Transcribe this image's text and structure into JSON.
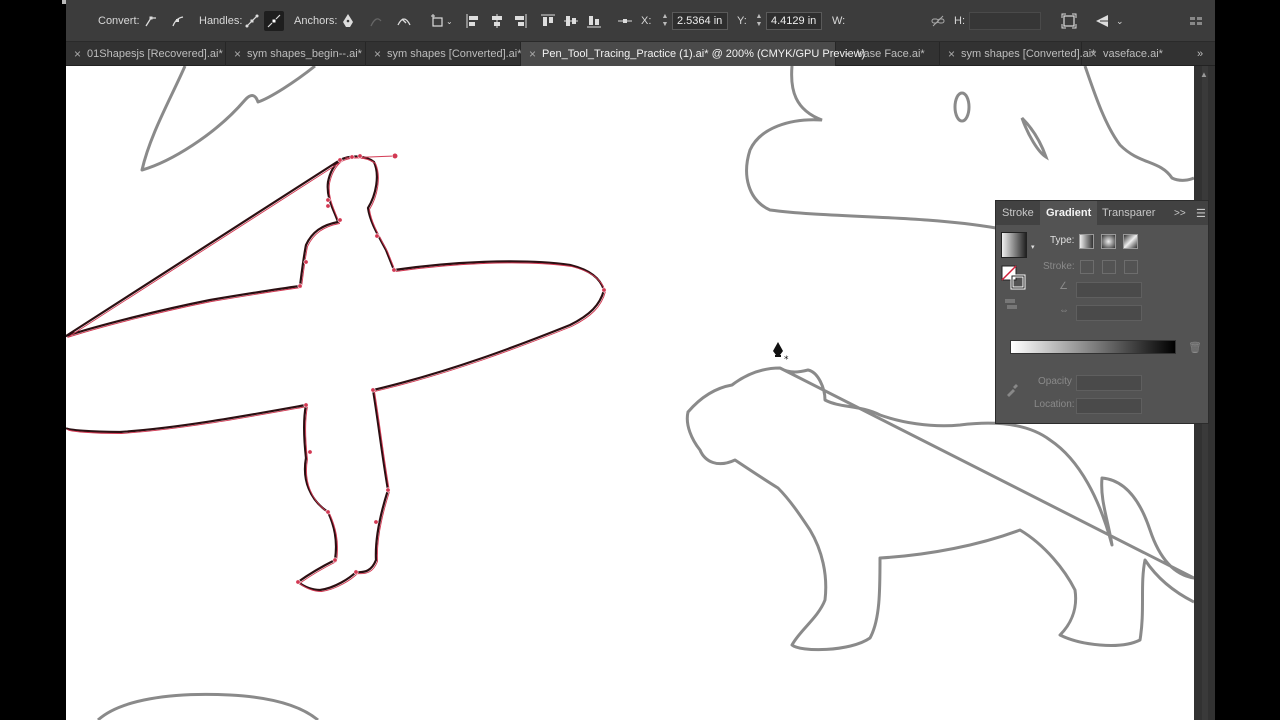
{
  "control_bar": {
    "convert_label": "Convert:",
    "handles_label": "Handles:",
    "anchors_label": "Anchors:",
    "x_label": "X:",
    "x_value": "2.5364 in",
    "y_label": "Y:",
    "y_value": "4.4129 in",
    "w_label": "W:",
    "h_label": "H:"
  },
  "tabs": [
    {
      "label": "01Shapesjs [Recovered].ai*",
      "active": false
    },
    {
      "label": "sym shapes_begin--.ai*",
      "active": false
    },
    {
      "label": "sym shapes [Converted].ai*",
      "active": false
    },
    {
      "label": "Pen_Tool_Tracing_Practice (1).ai* @ 200% (CMYK/GPU Preview)",
      "active": true
    },
    {
      "label": "Vase Face.ai*",
      "active": false
    },
    {
      "label": "sym shapes [Converted].ai*",
      "active": false
    },
    {
      "label": "vaseface.ai*",
      "active": false
    }
  ],
  "tab_close_glyph": "×",
  "tab_overflow": "»",
  "gradient_panel": {
    "tabs": [
      "Stroke",
      "Gradient",
      "Transparer"
    ],
    "active_tab": "Gradient",
    "type_label": "Type:",
    "stroke_label": "Stroke:",
    "opacity_label": "Opacity",
    "location_label": "Location:",
    "overflow": ">>"
  },
  "colors": {
    "accent_path": "#c8304a",
    "silhouette_gray": "#8a8a8a",
    "ui_dark": "#3c3c3c",
    "canvas": "#ffffff"
  },
  "icons": [
    "convert-corner-icon",
    "convert-smooth-icon",
    "handles-show-icon",
    "handles-hide-icon",
    "pen-tool-icon",
    "align-left-icon",
    "align-center-icon",
    "align-right-icon",
    "align-top-icon",
    "align-middle-icon",
    "align-bottom-icon",
    "link-icon",
    "transform-icon",
    "pen-cursor-icon",
    "gradient-swatch-icon",
    "trash-icon",
    "eyedropper-icon"
  ]
}
